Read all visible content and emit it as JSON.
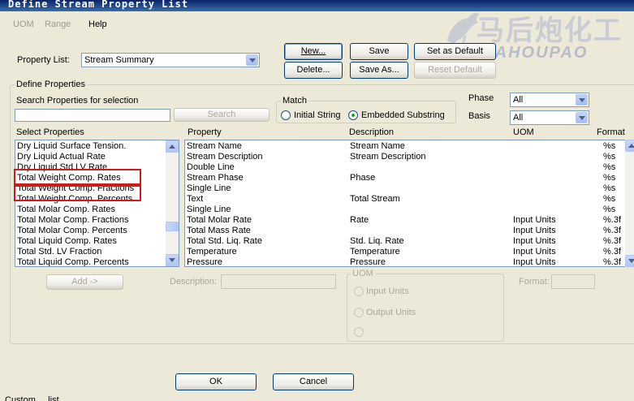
{
  "window": {
    "title": "Define Stream Property List"
  },
  "menu": [
    {
      "label": "UOM",
      "enabled": false
    },
    {
      "label": "Range",
      "enabled": false
    },
    {
      "label": "Help",
      "enabled": true
    }
  ],
  "watermark": {
    "cn": "马后炮化工",
    "en": "MAHOUPAO"
  },
  "property_list": {
    "label": "Property List:",
    "value": "Stream Summary"
  },
  "toolbar": {
    "new": "New...",
    "save": "Save",
    "set_default": "Set as Default",
    "delete": "Delete...",
    "save_as": "Save As...",
    "reset_default": "Reset Default"
  },
  "define_properties": {
    "title": "Define Properties",
    "search_label": "Search Properties for selection",
    "search_button": "Search",
    "match": {
      "title": "Match",
      "initial_string": "Initial String",
      "embedded_substring": "Embedded Substring",
      "selected": "embedded_substring"
    },
    "phase": {
      "label": "Phase",
      "value": "All"
    },
    "basis": {
      "label": "Basis",
      "value": "All"
    }
  },
  "select_properties": {
    "label": "Select Properties",
    "items": [
      "Dry Liquid Surface Tension.",
      "Dry Liquid Actual Rate",
      "Dry Liquid Std LV Rate",
      "Total Weight Comp. Rates",
      "Total Weight Comp. Fractions",
      "Total Weight Comp. Percents",
      "Total Molar Comp. Rates",
      "Total Molar Comp. Fractions",
      "Total Molar Comp. Percents",
      "Total Liquid Comp. Rates",
      "Total Std. LV Fraction",
      "Total Liquid Comp. Percents"
    ]
  },
  "property_table": {
    "headers": {
      "property": "Property",
      "description": "Description",
      "uom": "UOM",
      "format": "Format"
    },
    "rows": [
      {
        "property": "Stream Name",
        "description": "Stream Name",
        "uom": "",
        "format": "%s"
      },
      {
        "property": "Stream Description",
        "description": "Stream Description",
        "uom": "",
        "format": "%s"
      },
      {
        "property": "Double Line",
        "description": "",
        "uom": "",
        "format": "%s"
      },
      {
        "property": "Stream Phase",
        "description": "Phase",
        "uom": "",
        "format": "%s"
      },
      {
        "property": "Single Line",
        "description": "",
        "uom": "",
        "format": "%s"
      },
      {
        "property": "Text",
        "description": "Total Stream",
        "uom": "",
        "format": "%s"
      },
      {
        "property": "Single Line",
        "description": "",
        "uom": "",
        "format": "%s"
      },
      {
        "property": "Total Molar Rate",
        "description": "Rate",
        "uom": "Input Units",
        "format": "%.3f"
      },
      {
        "property": "Total Mass Rate",
        "description": "",
        "uom": "Input Units",
        "format": "%.3f"
      },
      {
        "property": "Total Std. Liq. Rate",
        "description": "Std. Liq. Rate",
        "uom": "Input Units",
        "format": "%.3f"
      },
      {
        "property": "Temperature",
        "description": "Temperature",
        "uom": "Input Units",
        "format": "%.3f"
      },
      {
        "property": "Pressure",
        "description": "Pressure",
        "uom": "Input Units",
        "format": "%.3f"
      }
    ]
  },
  "lower": {
    "add": "Add ->",
    "description_label": "Description:",
    "uom_title": "UOM",
    "input_units": "Input Units",
    "output_units": "Output Units",
    "format_label": "Format:"
  },
  "dialog": {
    "ok": "OK",
    "cancel": "Cancel"
  },
  "status": {
    "text": "Custom ... list"
  },
  "colors": {
    "highlight": "#d21a1a",
    "title_bar": "#0a246a",
    "background": "#ece9d8"
  }
}
